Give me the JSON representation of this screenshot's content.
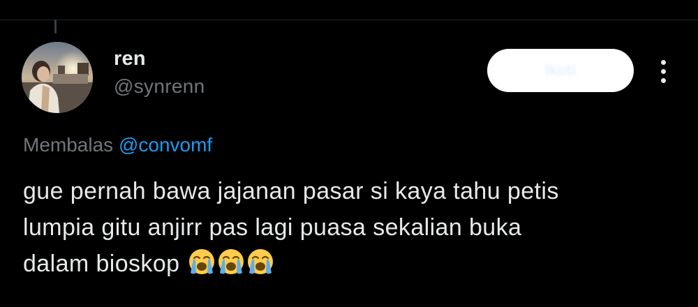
{
  "tweet": {
    "author": {
      "display_name": "ren",
      "handle": "@synrenn"
    },
    "follow_button_label": "Ikuti",
    "reply_context": {
      "prefix": "Membalas",
      "mention": "@convomf"
    },
    "text_lines": [
      "gue pernah bawa jajanan pasar si kaya tahu petis",
      "lumpia gitu anjirr pas lagi puasa sekalian buka",
      "dalam bioskop"
    ],
    "emojis": [
      "loudly-crying-face-icon",
      "loudly-crying-face-icon",
      "loudly-crying-face-icon"
    ]
  },
  "colors": {
    "background": "#000000",
    "primary_text": "#e7e9ea",
    "secondary_text": "#71767b",
    "link": "#1d9bf0",
    "follow_button_bg": "#ffffff"
  }
}
